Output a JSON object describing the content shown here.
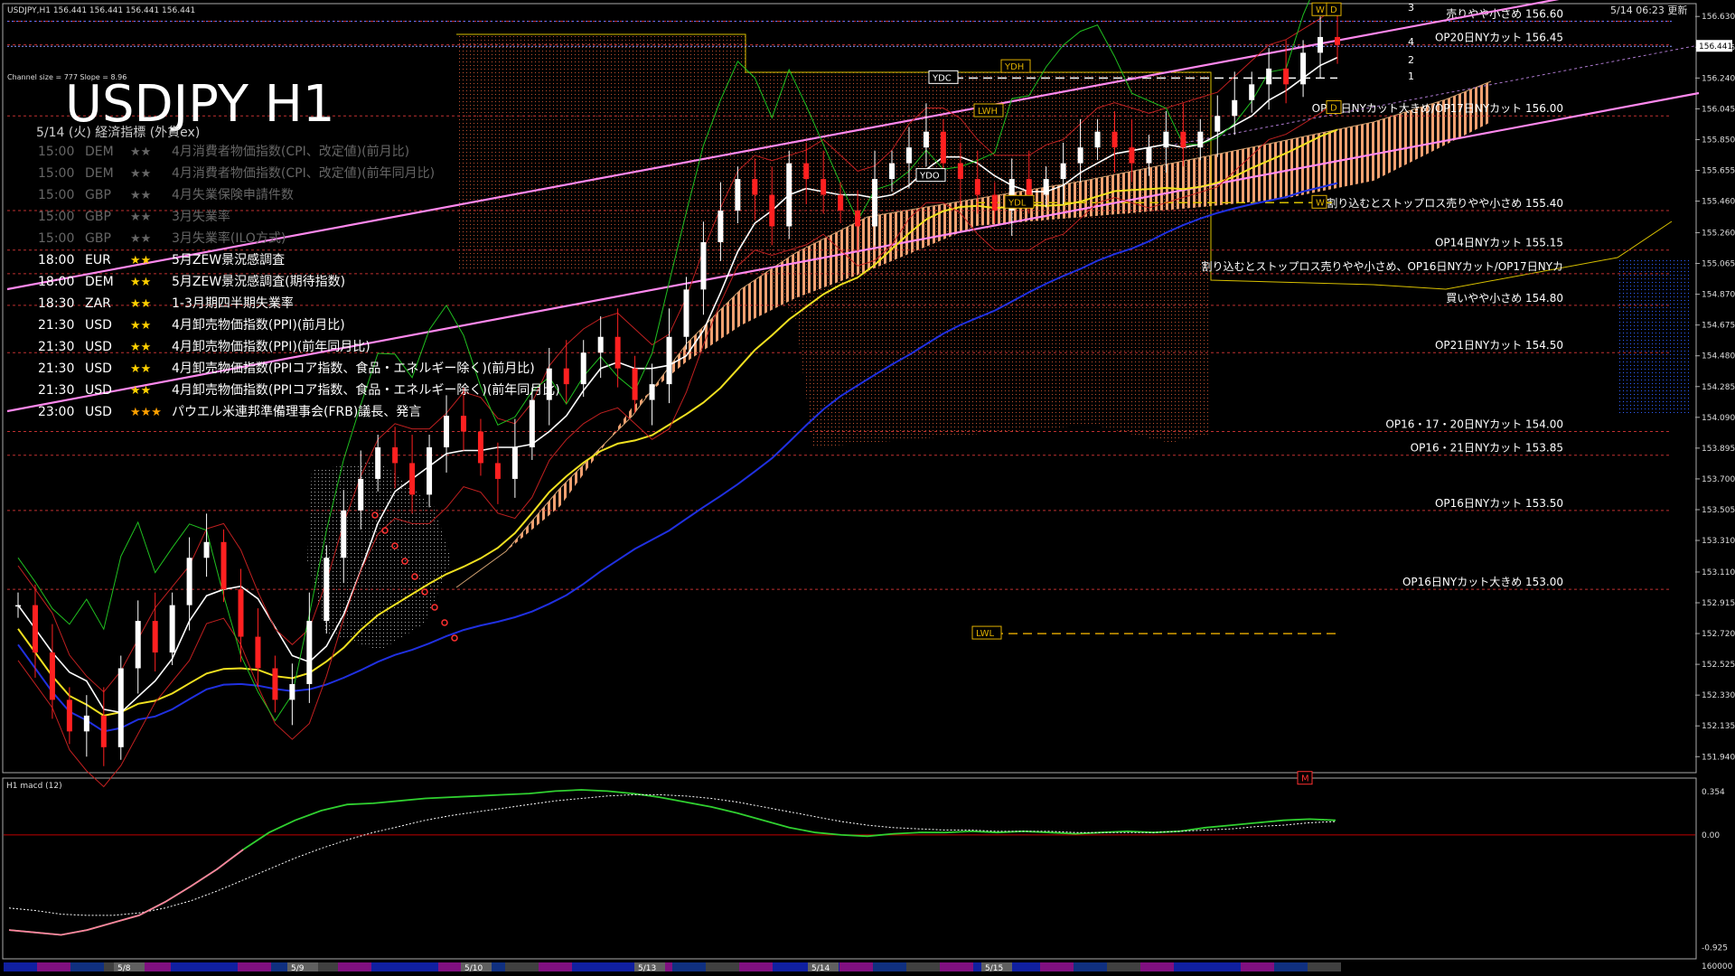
{
  "header": {
    "symbol_bar": "USDJPY,H1  156.441 156.441 156.441 156.441",
    "channel_info": "Channel size = 777 Slope = 8.96",
    "title": "USDJPY H1",
    "update_time": "5/14 06:23 更新"
  },
  "calendar": {
    "heading": "5/14 (火) 経済指標 (外貨ex)",
    "events": [
      {
        "time": "15:00",
        "cur": "DEM",
        "stars": "★★",
        "text": "4月消費者物価指数(CPI、改定値)(前月比)",
        "past": true
      },
      {
        "time": "15:00",
        "cur": "DEM",
        "stars": "★★",
        "text": "4月消費者物価指数(CPI、改定値)(前年同月比)",
        "past": true
      },
      {
        "time": "15:00",
        "cur": "GBP",
        "stars": "★★",
        "text": "4月失業保険申請件数",
        "past": true
      },
      {
        "time": "15:00",
        "cur": "GBP",
        "stars": "★★",
        "text": "3月失業率",
        "past": true
      },
      {
        "time": "15:00",
        "cur": "GBP",
        "stars": "★★",
        "text": "3月失業率(ILO方式)",
        "past": true
      },
      {
        "time": "18:00",
        "cur": "EUR",
        "stars": "★★",
        "text": "5月ZEW景況感調査",
        "past": false
      },
      {
        "time": "18:00",
        "cur": "DEM",
        "stars": "★★",
        "text": "5月ZEW景況感調査(期待指数)",
        "past": false
      },
      {
        "time": "18:30",
        "cur": "ZAR",
        "stars": "★★",
        "text": "1-3月期四半期失業率",
        "past": false
      },
      {
        "time": "21:30",
        "cur": "USD",
        "stars": "★★",
        "text": "4月卸売物価指数(PPI)(前月比)",
        "past": false
      },
      {
        "time": "21:30",
        "cur": "USD",
        "stars": "★★",
        "text": "4月卸売物価指数(PPI)(前年同月比)",
        "past": false
      },
      {
        "time": "21:30",
        "cur": "USD",
        "stars": "★★",
        "text": "4月卸売物価指数(PPIコア指数、食品・エネルギー除く)(前月比)",
        "past": false
      },
      {
        "time": "21:30",
        "cur": "USD",
        "stars": "★★",
        "text": "4月卸売物価指数(PPIコア指数、食品・エネルギー除く)(前年同月比)",
        "past": false
      },
      {
        "time": "23:00",
        "cur": "USD",
        "stars": "★★★",
        "text": "パウエル米連邦準備理事会(FRB)議長、発言",
        "past": false
      }
    ]
  },
  "chart_data": {
    "type": "line",
    "title": "USDJPY H1",
    "ylim": [
      151.85,
      156.7
    ],
    "price_axis": [
      "156.630",
      "156.435",
      "156.240",
      "156.045",
      "155.850",
      "155.655",
      "155.460",
      "155.260",
      "155.065",
      "154.870",
      "154.675",
      "154.480",
      "154.285",
      "154.090",
      "153.895",
      "153.700",
      "153.505",
      "153.310",
      "153.110",
      "152.915",
      "152.720",
      "152.525",
      "152.330",
      "152.135",
      "151.940"
    ],
    "current_price": "156.441",
    "x_dates": [
      "5/8",
      "5/9",
      "5/10",
      "5/13",
      "5/14",
      "5/15"
    ],
    "annotations": [
      {
        "price": 156.6,
        "text": "売りやや小さめ 156.60",
        "color": "#ffffff"
      },
      {
        "price": 156.45,
        "text": "OP20日NYカット 156.45",
        "color": "#ffffff"
      },
      {
        "price": 156.0,
        "text": "OP15日NYカット大きめ/OP17日NYカット 156.00",
        "color": "#ffffff"
      },
      {
        "price": 155.4,
        "text": "割り込むとストップロス売りやや小さめ 155.40",
        "color": "#ffffff"
      },
      {
        "price": 155.15,
        "text": "OP14日NYカット 155.15",
        "color": "#ffffff"
      },
      {
        "price": 155.0,
        "text": "割り込むとストップロス売りやや小さめ、OP16日NYカット/OP17日NYカ",
        "color": "#ffffff"
      },
      {
        "price": 154.8,
        "text": "買いやや小さめ 154.80",
        "color": "#ffffff"
      },
      {
        "price": 154.5,
        "text": "OP21日NYカット 154.50",
        "color": "#ffffff"
      },
      {
        "price": 154.0,
        "text": "OP16・17・20日NYカット 154.00",
        "color": "#ffffff"
      },
      {
        "price": 153.85,
        "text": "OP16・21日NYカット 153.85",
        "color": "#ffffff"
      },
      {
        "price": 153.5,
        "text": "OP16日NYカット 153.50",
        "color": "#ffffff"
      },
      {
        "price": 153.0,
        "text": "OP16日NYカット大きめ 153.00",
        "color": "#ffffff"
      }
    ],
    "level_labels": [
      {
        "text": "YDC",
        "price": 156.24
      },
      {
        "text": "YDH",
        "price": 156.31
      },
      {
        "text": "LWH",
        "price": 156.03
      },
      {
        "text": "YDO",
        "price": 155.62
      },
      {
        "text": "YDL",
        "price": 155.45
      },
      {
        "text": "W",
        "price": 156.67
      },
      {
        "text": "D",
        "price": 156.67
      },
      {
        "text": "D",
        "price": 156.05
      },
      {
        "text": "W",
        "price": 155.45
      },
      {
        "text": "LWL",
        "price": 152.72
      },
      {
        "text": "M",
        "price": 151.8
      }
    ],
    "channel_numbers": [
      "3",
      "4",
      "2",
      "1"
    ],
    "close_series": [
      152.9,
      152.6,
      152.3,
      152.1,
      152.2,
      152.0,
      152.5,
      152.8,
      152.6,
      152.9,
      153.2,
      153.3,
      153.0,
      152.7,
      152.5,
      152.3,
      152.4,
      152.8,
      153.2,
      153.5,
      153.7,
      153.9,
      153.8,
      153.6,
      153.9,
      154.1,
      154.0,
      153.8,
      153.7,
      153.9,
      154.2,
      154.4,
      154.3,
      154.5,
      154.6,
      154.4,
      154.2,
      154.3,
      154.6,
      154.9,
      155.2,
      155.4,
      155.6,
      155.5,
      155.3,
      155.7,
      155.6,
      155.5,
      155.4,
      155.3,
      155.6,
      155.7,
      155.8,
      155.9,
      155.7,
      155.6,
      155.5,
      155.4,
      155.6,
      155.5,
      155.6,
      155.7,
      155.8,
      155.9,
      155.8,
      155.7,
      155.8,
      155.9,
      155.8,
      155.9,
      156.0,
      156.1,
      156.2,
      156.3,
      156.2,
      156.4,
      156.5,
      156.45
    ]
  },
  "macd": {
    "label": "H1  macd (12)",
    "axis": [
      "0.354",
      "0.00",
      "-0.925"
    ],
    "right_value": "160000",
    "main": [
      -0.78,
      -0.8,
      -0.82,
      -0.78,
      -0.72,
      -0.66,
      -0.55,
      -0.42,
      -0.28,
      -0.12,
      0.02,
      0.12,
      0.2,
      0.25,
      0.26,
      0.28,
      0.3,
      0.31,
      0.32,
      0.33,
      0.34,
      0.36,
      0.37,
      0.36,
      0.34,
      0.31,
      0.27,
      0.23,
      0.18,
      0.12,
      0.06,
      0.02,
      0.0,
      -0.01,
      0.01,
      0.02,
      0.02,
      0.03,
      0.02,
      0.03,
      0.02,
      0.01,
      0.02,
      0.03,
      0.02,
      0.03,
      0.06,
      0.08,
      0.1,
      0.12,
      0.13,
      0.12
    ],
    "signal": [
      -0.6,
      -0.62,
      -0.65,
      -0.66,
      -0.66,
      -0.64,
      -0.6,
      -0.54,
      -0.46,
      -0.37,
      -0.28,
      -0.19,
      -0.11,
      -0.04,
      0.02,
      0.07,
      0.12,
      0.16,
      0.19,
      0.22,
      0.25,
      0.28,
      0.3,
      0.32,
      0.33,
      0.33,
      0.32,
      0.3,
      0.27,
      0.23,
      0.19,
      0.15,
      0.11,
      0.08,
      0.06,
      0.05,
      0.04,
      0.04,
      0.03,
      0.03,
      0.03,
      0.02,
      0.02,
      0.02,
      0.02,
      0.03,
      0.04,
      0.05,
      0.07,
      0.08,
      0.1,
      0.11
    ]
  }
}
